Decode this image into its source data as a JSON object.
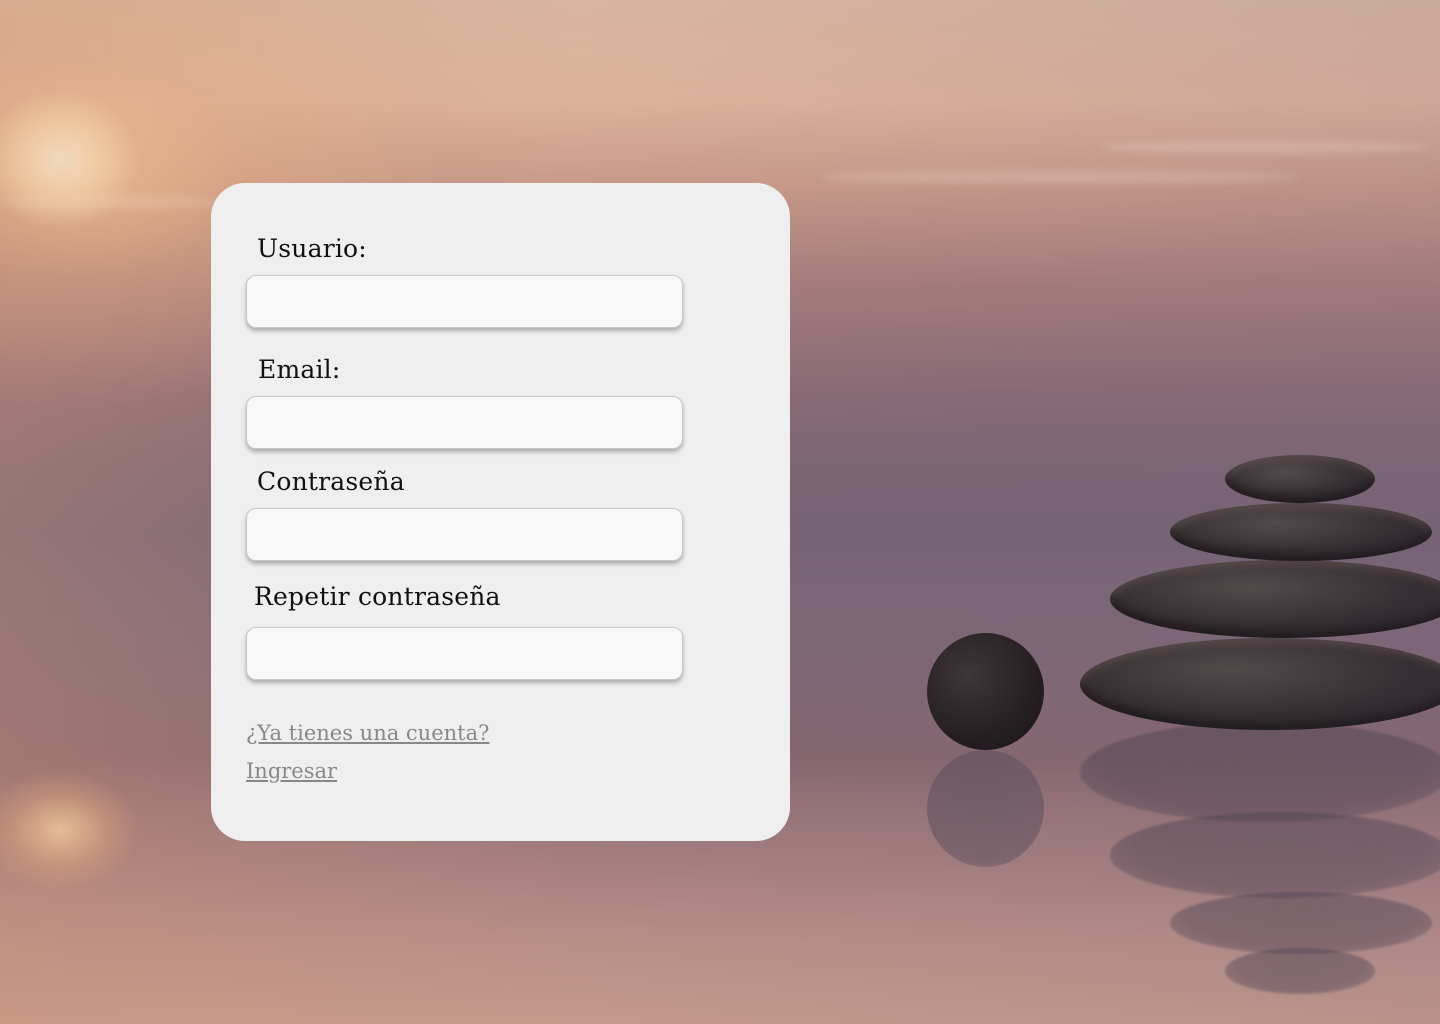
{
  "form": {
    "username_label": "Usuario:",
    "username_value": "",
    "email_label": "Email:",
    "email_value": "",
    "password_label": "Contraseña",
    "password_value": "",
    "repeat_password_label": "Repetir contraseña",
    "repeat_password_value": ""
  },
  "footer": {
    "have_account_link": "¿Ya tienes una cuenta?",
    "login_link": "Ingresar"
  },
  "colors": {
    "card_background": "#efefef",
    "input_background": "#f8f8f8",
    "link_color": "#888888",
    "label_color": "#111111"
  }
}
